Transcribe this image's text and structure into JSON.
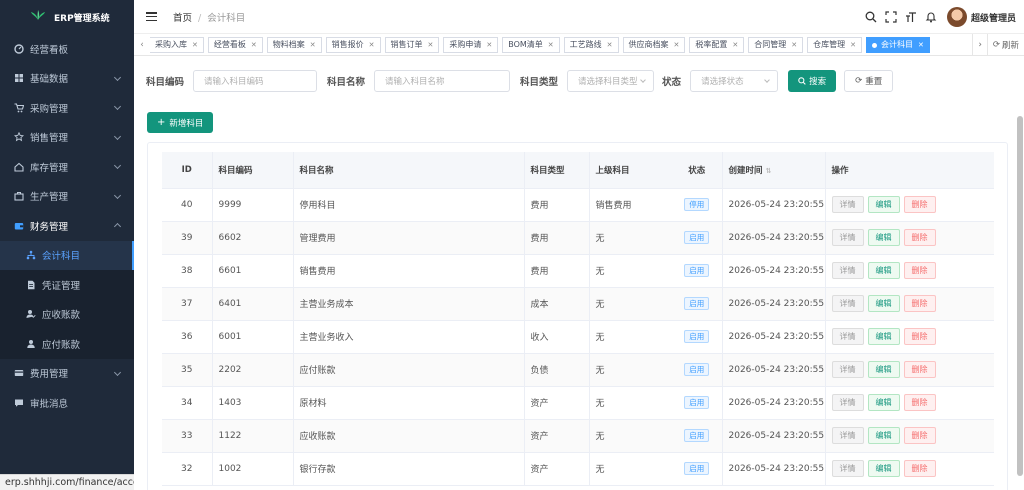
{
  "app": {
    "title": "ERP管理系统"
  },
  "sidebar": {
    "items": [
      {
        "label": "经营看板",
        "icon": "dashboard-icon",
        "has_children": false
      },
      {
        "label": "基础数据",
        "icon": "grid-icon",
        "has_children": true
      },
      {
        "label": "采购管理",
        "icon": "cart-icon",
        "has_children": true
      },
      {
        "label": "销售管理",
        "icon": "star-icon",
        "has_children": true
      },
      {
        "label": "库存管理",
        "icon": "home-icon",
        "has_children": true
      },
      {
        "label": "生产管理",
        "icon": "suitcase-icon",
        "has_children": true
      },
      {
        "label": "财务管理",
        "icon": "wallet-icon",
        "has_children": true,
        "open": true
      },
      {
        "label": "费用管理",
        "icon": "card-icon",
        "has_children": true
      },
      {
        "label": "审批消息",
        "icon": "message-icon",
        "has_children": false
      }
    ],
    "finance_sub": [
      {
        "label": "会计科目",
        "icon": "tree-icon",
        "active": true
      },
      {
        "label": "凭证管理",
        "icon": "doc-icon"
      },
      {
        "label": "应收账款",
        "icon": "user-check-icon"
      },
      {
        "label": "应付账款",
        "icon": "user-icon"
      }
    ]
  },
  "status_url": "erp.shhhji.com/finance/account",
  "header": {
    "breadcrumb": [
      "首页",
      "会计科目"
    ],
    "username": "超级管理员"
  },
  "tags": [
    {
      "label": "采购入库"
    },
    {
      "label": "经营看板"
    },
    {
      "label": "物料档案"
    },
    {
      "label": "销售报价"
    },
    {
      "label": "销售订单"
    },
    {
      "label": "采购申请"
    },
    {
      "label": "BOM清单"
    },
    {
      "label": "工艺路线"
    },
    {
      "label": "供应商档案"
    },
    {
      "label": "税率配置"
    },
    {
      "label": "合同管理"
    },
    {
      "label": "仓库管理"
    },
    {
      "label": "会计科目",
      "active": true
    }
  ],
  "tags_refresh": "刷新",
  "search": {
    "code_label": "科目编码",
    "code_placeholder": "请输入科目编码",
    "name_label": "科目名称",
    "name_placeholder": "请输入科目名称",
    "type_label": "科目类型",
    "type_placeholder": "请选择科目类型",
    "status_label": "状态",
    "status_placeholder": "请选择状态",
    "search_btn": "搜索",
    "reset_btn": "重置"
  },
  "add_btn": "新增科目",
  "table": {
    "headers": [
      "ID",
      "科目编码",
      "科目名称",
      "科目类型",
      "上级科目",
      "状态",
      "创建时间",
      "操作"
    ],
    "op_labels": {
      "detail": "详情",
      "edit": "编辑",
      "delete": "删除"
    },
    "rows": [
      {
        "id": "40",
        "code": "9999",
        "name": "停用科目",
        "type": "费用",
        "parent": "销售费用",
        "status": "停用",
        "time": "2026-05-24 23:20:55"
      },
      {
        "id": "39",
        "code": "6602",
        "name": "管理费用",
        "type": "费用",
        "parent": "无",
        "status": "启用",
        "time": "2026-05-24 23:20:55"
      },
      {
        "id": "38",
        "code": "6601",
        "name": "销售费用",
        "type": "费用",
        "parent": "无",
        "status": "启用",
        "time": "2026-05-24 23:20:55"
      },
      {
        "id": "37",
        "code": "6401",
        "name": "主营业务成本",
        "type": "成本",
        "parent": "无",
        "status": "启用",
        "time": "2026-05-24 23:20:55"
      },
      {
        "id": "36",
        "code": "6001",
        "name": "主营业务收入",
        "type": "收入",
        "parent": "无",
        "status": "启用",
        "time": "2026-05-24 23:20:55"
      },
      {
        "id": "35",
        "code": "2202",
        "name": "应付账款",
        "type": "负债",
        "parent": "无",
        "status": "启用",
        "time": "2026-05-24 23:20:55"
      },
      {
        "id": "34",
        "code": "1403",
        "name": "原材料",
        "type": "资产",
        "parent": "无",
        "status": "启用",
        "time": "2026-05-24 23:20:55"
      },
      {
        "id": "33",
        "code": "1122",
        "name": "应收账款",
        "type": "资产",
        "parent": "无",
        "status": "启用",
        "time": "2026-05-24 23:20:55"
      },
      {
        "id": "32",
        "code": "1002",
        "name": "银行存款",
        "type": "资产",
        "parent": "无",
        "status": "启用",
        "time": "2026-05-24 23:20:55"
      }
    ]
  },
  "colors": {
    "primary": "#13957d",
    "sidebar_bg": "#1f2a3a",
    "active_tag": "#409eff"
  }
}
